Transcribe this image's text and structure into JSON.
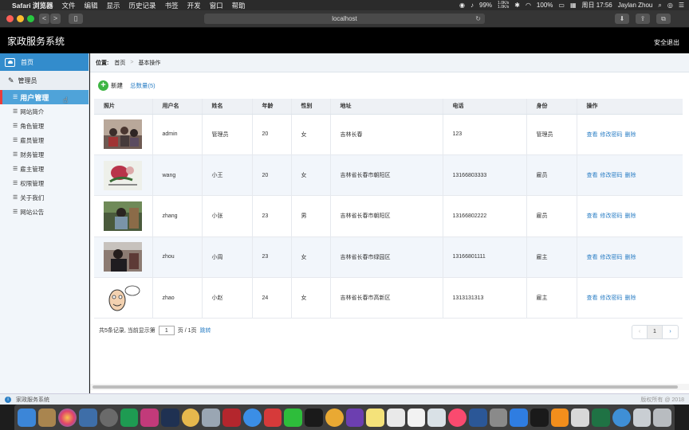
{
  "menubar": {
    "app": "Safari 浏览器",
    "items": [
      "文件",
      "编辑",
      "显示",
      "历史记录",
      "书签",
      "开发",
      "窗口",
      "帮助"
    ],
    "battery": "99%",
    "net_up": "1.0K/s",
    "net_down": "1.0K/s",
    "battery2": "100%",
    "clock": "周日 17:56",
    "user": "Jaylan Zhou"
  },
  "browser": {
    "url": "localhost",
    "back": "<",
    "forward": ">"
  },
  "header": {
    "title": "家政服务系统",
    "logout": "安全退出"
  },
  "sidebar": {
    "home": "首页",
    "section": "管理员",
    "items": [
      {
        "label": "用户管理"
      },
      {
        "label": "网站简介"
      },
      {
        "label": "角色管理"
      },
      {
        "label": "雇员管理"
      },
      {
        "label": "财务管理"
      },
      {
        "label": "雇主管理"
      },
      {
        "label": "权限管理"
      },
      {
        "label": "关于我们"
      },
      {
        "label": "网站公告"
      }
    ]
  },
  "breadcrumb": {
    "label": "位置:",
    "home": "首页",
    "sep": ">",
    "current": "基本操作"
  },
  "toolbar": {
    "new": "新建",
    "total": "总数量(5)"
  },
  "table": {
    "headers": [
      "照片",
      "用户名",
      "姓名",
      "年龄",
      "性别",
      "地址",
      "电话",
      "身份",
      "操作"
    ],
    "rows": [
      {
        "username": "admin",
        "name": "管理员",
        "age": "20",
        "gender": "女",
        "address": "吉林长春",
        "phone": "123",
        "role": "管理员"
      },
      {
        "username": "wang",
        "name": "小王",
        "age": "20",
        "gender": "女",
        "address": "吉林省长春市朝阳区",
        "phone": "13166803333",
        "role": "雇员"
      },
      {
        "username": "zhang",
        "name": "小张",
        "age": "23",
        "gender": "男",
        "address": "吉林省长春市朝阳区",
        "phone": "13166802222",
        "role": "雇员"
      },
      {
        "username": "zhou",
        "name": "小周",
        "age": "23",
        "gender": "女",
        "address": "吉林省长春市绿园区",
        "phone": "13166801111",
        "role": "雇主"
      },
      {
        "username": "zhao",
        "name": "小赵",
        "age": "24",
        "gender": "女",
        "address": "吉林省长春市高新区",
        "phone": "1313131313",
        "role": "雇主"
      }
    ],
    "op_view": "查看",
    "op_password": "修改密码",
    "op_delete": "删除"
  },
  "pagination": {
    "prefix": "共5条记录,  当前显示第",
    "page_input": "1",
    "suffix": "页 / 1页",
    "jump": "跳转",
    "prev": "‹",
    "current": "1",
    "next": "›"
  },
  "status": {
    "left": "家政服务系统",
    "right": "版权所有 @ 2018"
  },
  "colors": {
    "accent": "#338ccc",
    "active_item": "#4fa3d9",
    "link": "#2c7fc5",
    "plus": "#3eb543"
  }
}
